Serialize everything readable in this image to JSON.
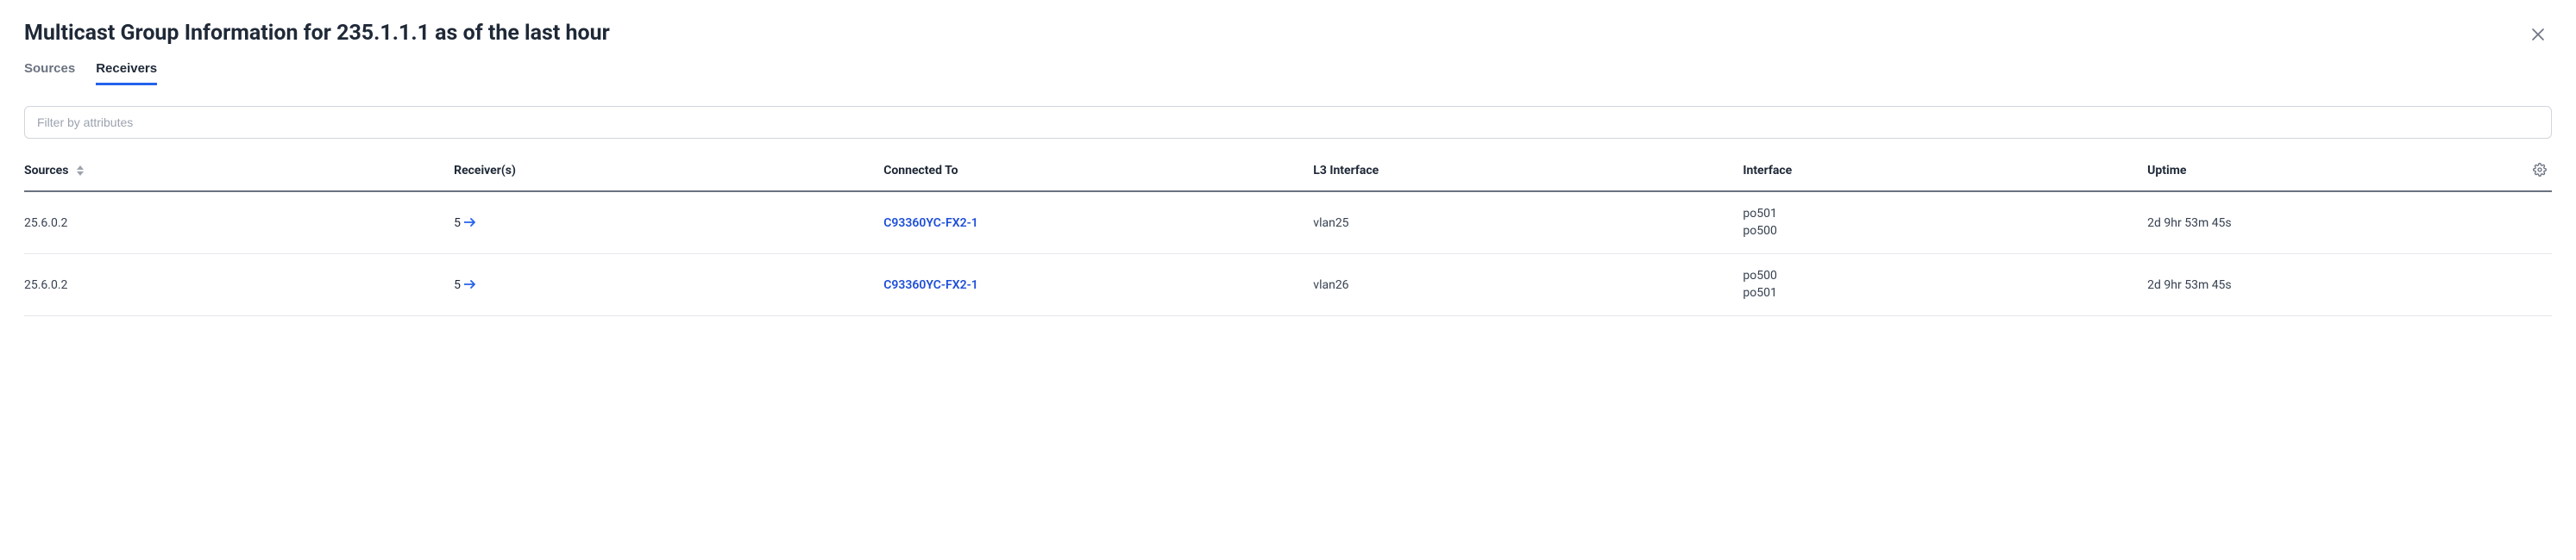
{
  "header": {
    "title": "Multicast Group Information for 235.1.1.1 as of the last hour"
  },
  "tabs": {
    "sources": "Sources",
    "receivers": "Receivers",
    "active": "receivers"
  },
  "filter": {
    "placeholder": "Filter by attributes",
    "value": ""
  },
  "columns": {
    "sources": "Sources",
    "receivers": "Receiver(s)",
    "connected_to": "Connected To",
    "l3_interface": "L3 Interface",
    "interface": "Interface",
    "uptime": "Uptime"
  },
  "rows": [
    {
      "source": "25.6.0.2",
      "receivers": "5",
      "connected_to": "C93360YC-FX2-1",
      "l3_interface": "vlan25",
      "interfaces": [
        "po501",
        "po500"
      ],
      "uptime": "2d 9hr 53m 45s"
    },
    {
      "source": "25.6.0.2",
      "receivers": "5",
      "connected_to": "C93360YC-FX2-1",
      "l3_interface": "vlan26",
      "interfaces": [
        "po500",
        "po501"
      ],
      "uptime": "2d 9hr 53m 45s"
    }
  ]
}
